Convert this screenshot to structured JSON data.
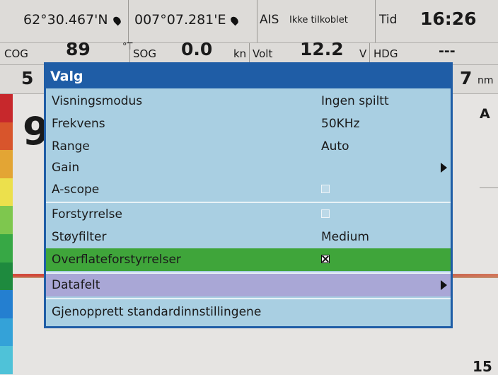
{
  "status": {
    "lat": "62°30.467'N",
    "lon": "007°07.281'E",
    "ais_label": "AIS",
    "ais_status": "Ikke tilkoblet",
    "time_label": "Tid",
    "time": "16:26"
  },
  "instruments": {
    "cog_label": "COG",
    "cog_value": "89",
    "cog_unit": "°T",
    "sog_label": "SOG",
    "sog_value": "0.0",
    "sog_unit": "kn",
    "volt_label": "Volt",
    "volt_value": "12.2",
    "volt_unit": "V",
    "hdg_label": "HDG",
    "hdg_value": "---"
  },
  "row3": {
    "left_partial": "5",
    "right_partial": "7",
    "right_unit": "nm"
  },
  "display": {
    "depth_partial": "9",
    "right_label": "A",
    "bottom_number": "15"
  },
  "menu": {
    "title": "Valg",
    "items": [
      {
        "label": "Visningsmodus",
        "value": "Ingen spiltt"
      },
      {
        "label": "Frekvens",
        "value": "50KHz"
      },
      {
        "label": "Range",
        "value": "Auto"
      },
      {
        "label": "Gain",
        "value": ""
      },
      {
        "label": "A-scope",
        "value": ""
      },
      {
        "label": "Forstyrrelse",
        "value": ""
      },
      {
        "label": "Støyfilter",
        "value": "Medium"
      },
      {
        "label": "Overflateforstyrrelser",
        "value": ""
      },
      {
        "label": "Datafelt",
        "value": ""
      },
      {
        "label": "Gjenopprett standardinnstillingene",
        "value": ""
      }
    ],
    "checkboxes": {
      "ascope": false,
      "forstyrrelse": false,
      "overflate": true
    },
    "colors": {
      "title_bar": "#1f5da6",
      "background": "#a9cfe2",
      "selected": "#3fa53a",
      "hover": "#a9a7d6"
    }
  }
}
